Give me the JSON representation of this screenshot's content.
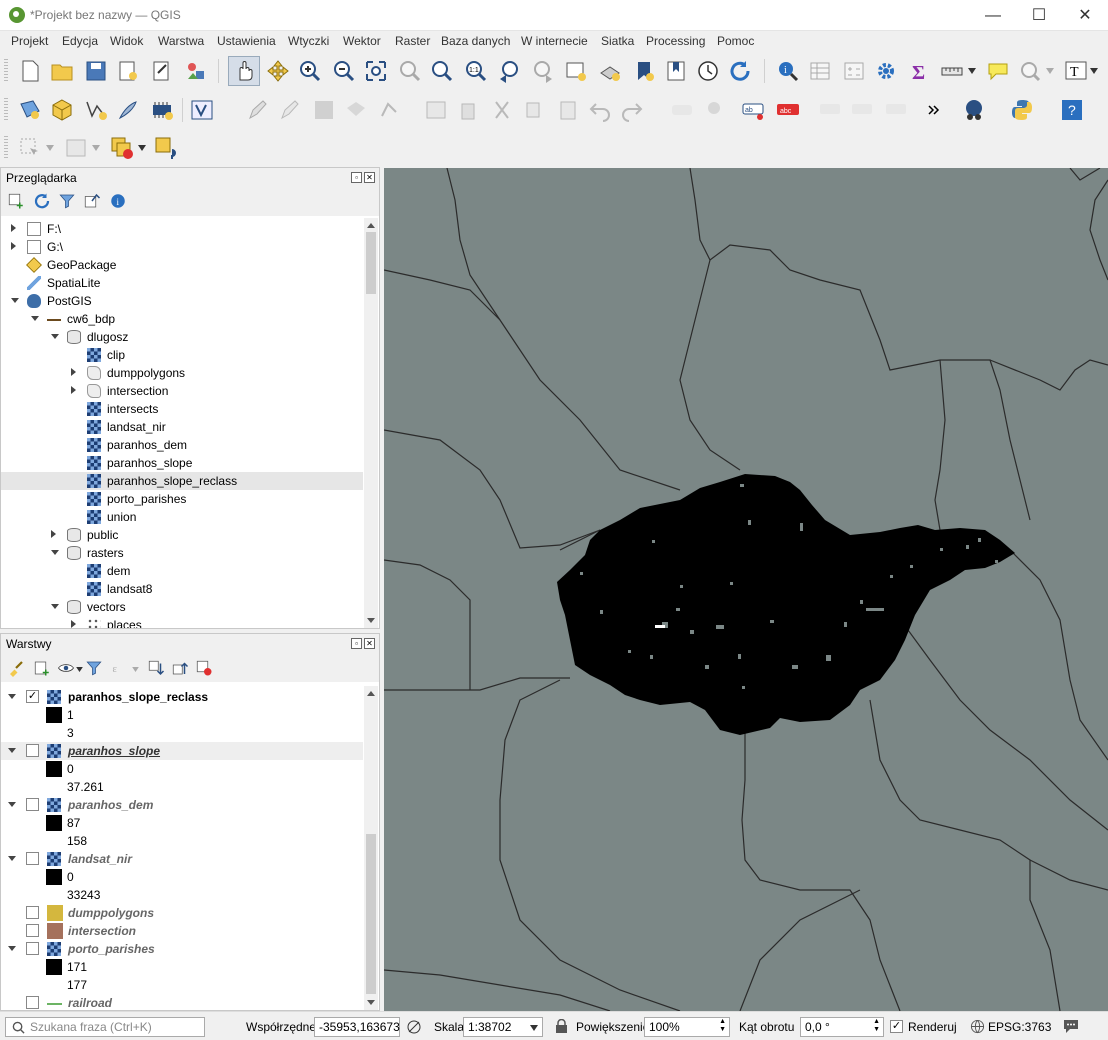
{
  "window": {
    "title": "*Projekt bez nazwy — QGIS",
    "minimize": "—",
    "maximize": "☐",
    "close": "✕"
  },
  "menu": [
    "Projekt",
    "Edycja",
    "Widok",
    "Warstwa",
    "Ustawienia",
    "Wtyczki",
    "Wektor",
    "Raster",
    "Baza danych",
    "W internecie",
    "Siatka",
    "Processing",
    "Pomoc"
  ],
  "browser": {
    "title": "Przeglądarka",
    "items": [
      {
        "label": "F:\\",
        "icon": "folder-icon",
        "expander": "right"
      },
      {
        "label": "G:\\",
        "icon": "folder-icon",
        "expander": "right"
      },
      {
        "label": "GeoPackage",
        "icon": "geopackage-icon",
        "expander": ""
      },
      {
        "label": "SpatiaLite",
        "icon": "spatialite-icon",
        "expander": ""
      },
      {
        "label": "PostGIS",
        "icon": "postgis-icon",
        "expander": "down"
      },
      {
        "label": "cw6_bdp",
        "icon": "connection-icon",
        "expander": "down"
      },
      {
        "label": "dlugosz",
        "icon": "schema-icon",
        "expander": "down"
      },
      {
        "label": "clip",
        "icon": "raster-icon",
        "expander": ""
      },
      {
        "label": "dumppolygons",
        "icon": "polygon-icon",
        "expander": "right"
      },
      {
        "label": "intersection",
        "icon": "polygon-icon",
        "expander": "right"
      },
      {
        "label": "intersects",
        "icon": "raster-icon",
        "expander": ""
      },
      {
        "label": "landsat_nir",
        "icon": "raster-icon",
        "expander": ""
      },
      {
        "label": "paranhos_dem",
        "icon": "raster-icon",
        "expander": ""
      },
      {
        "label": "paranhos_slope",
        "icon": "raster-icon",
        "expander": ""
      },
      {
        "label": "paranhos_slope_reclass",
        "icon": "raster-icon",
        "expander": "",
        "selected": true
      },
      {
        "label": "porto_parishes",
        "icon": "raster-icon",
        "expander": ""
      },
      {
        "label": "union",
        "icon": "raster-icon",
        "expander": ""
      },
      {
        "label": "public",
        "icon": "schema-icon",
        "expander": "right"
      },
      {
        "label": "rasters",
        "icon": "schema-icon",
        "expander": "down"
      },
      {
        "label": "dem",
        "icon": "raster-icon",
        "expander": ""
      },
      {
        "label": "landsat8",
        "icon": "raster-icon",
        "expander": ""
      },
      {
        "label": "vectors",
        "icon": "schema-icon",
        "expander": "down"
      },
      {
        "label": "places",
        "icon": "points-icon",
        "expander": "right"
      }
    ]
  },
  "layers": {
    "title": "Warstwy",
    "items": [
      {
        "kind": "layer",
        "label": "paranhos_slope_reclass",
        "checked": true,
        "style": "bold"
      },
      {
        "kind": "legend",
        "label": "1",
        "color": "#000000"
      },
      {
        "kind": "legend",
        "label": "3",
        "color": ""
      },
      {
        "kind": "layer",
        "label": "paranhos_slope",
        "checked": false,
        "style": "italic-underline"
      },
      {
        "kind": "legend",
        "label": "0",
        "color": "#000000"
      },
      {
        "kind": "legend",
        "label": "37.261",
        "color": ""
      },
      {
        "kind": "layer",
        "label": "paranhos_dem",
        "checked": false,
        "style": "italic"
      },
      {
        "kind": "legend",
        "label": "87",
        "color": "#000000"
      },
      {
        "kind": "legend",
        "label": "158",
        "color": ""
      },
      {
        "kind": "layer",
        "label": "landsat_nir",
        "checked": false,
        "style": "italic"
      },
      {
        "kind": "legend",
        "label": "0",
        "color": "#000000"
      },
      {
        "kind": "legend",
        "label": "33243",
        "color": ""
      },
      {
        "kind": "vlayer",
        "label": "dumppolygons",
        "checked": false,
        "color": "#d4b73e"
      },
      {
        "kind": "vlayer",
        "label": "intersection",
        "checked": false,
        "color": "#a5715c"
      },
      {
        "kind": "layer",
        "label": "porto_parishes",
        "checked": false,
        "style": "italic"
      },
      {
        "kind": "legend",
        "label": "171",
        "color": "#000000"
      },
      {
        "kind": "legend",
        "label": "177",
        "color": ""
      },
      {
        "kind": "line",
        "label": "railroad",
        "checked": false,
        "color": "#6cb464"
      }
    ]
  },
  "status": {
    "search_placeholder": "Szukana fraza (Ctrl+K)",
    "coord_label": "Współrzędne",
    "coord_value": "-35953,163673",
    "scale_label": "Skala",
    "scale_value": "1:38702",
    "magnifier_label": "Powiększenie",
    "magnifier_value": "100%",
    "rotation_label": "Kąt obrotu",
    "rotation_value": "0,0 °",
    "render_label": "Renderuj",
    "crs_value": "EPSG:3763"
  },
  "colors": {
    "map_background": "#7b8786",
    "raster_fill": "#000000",
    "boundary": "#2b2b2b"
  }
}
